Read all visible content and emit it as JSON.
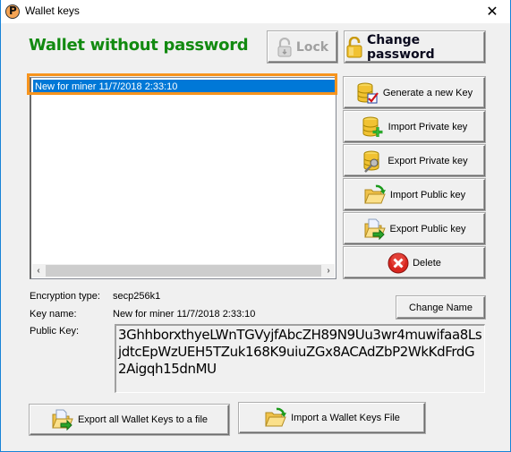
{
  "window": {
    "title": "Wallet keys",
    "close_label": "✕"
  },
  "header": {
    "status_title": "Wallet without password",
    "status_color": "#128a10",
    "lock_label": "Lock",
    "lock_enabled": false,
    "change_password_label": "Change password"
  },
  "key_list": {
    "items": [
      {
        "label": "New for miner 11/7/2018 2:33:10",
        "selected": true
      }
    ],
    "scroll_left": "‹",
    "scroll_right": "›"
  },
  "actions": {
    "generate_label": "Generate a new Key",
    "import_private_label": "Import Private key",
    "export_private_label": "Export Private key",
    "import_public_label": "Import Public key",
    "export_public_label": "Export Public key",
    "delete_label": "Delete"
  },
  "details": {
    "encryption_type_label": "Encryption type:",
    "encryption_type_value": "secp256k1",
    "key_name_label": "Key name:",
    "key_name_value": "New for miner 11/7/2018 2:33:10",
    "public_key_label": "Public Key:",
    "public_key_value": "3GhhborxthyeLWnTGVyjfAbcZH89N9Uu3wr4muwifaa8LsjdtcEpWzUEH5TZuk168K9uiuZGx8ACAdZbP2WkKdFrdG2Aigqh15dnMU",
    "change_name_label": "Change Name"
  },
  "footer": {
    "export_all_label": "Export all Wallet Keys to a file",
    "import_file_label": "Import a Wallet Keys File"
  },
  "colors": {
    "accent_selection": "#0078d7",
    "focus_ring": "#f7941d"
  }
}
